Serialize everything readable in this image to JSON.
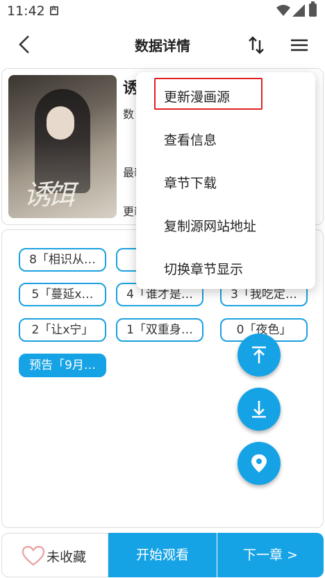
{
  "status": {
    "time": "11:42"
  },
  "header": {
    "title": "数据详情"
  },
  "info": {
    "title": "诱",
    "line1": "数",
    "line2": "最新",
    "line3": "更新"
  },
  "chapters": [
    {
      "label": "8「相识从…",
      "active": false
    },
    {
      "label": "7",
      "active": false
    },
    {
      "label": "5「蔓延x…",
      "active": false
    },
    {
      "label": "4「谁才是…",
      "active": false
    },
    {
      "label": "3「我吃定…",
      "active": false
    },
    {
      "label": "2「让x宁」",
      "active": false
    },
    {
      "label": "1「双重身…",
      "active": false
    },
    {
      "label": "0「夜色」",
      "active": false
    },
    {
      "label": "预告「9月…",
      "active": true
    }
  ],
  "menu": {
    "items": [
      "更新漫画源",
      "查看信息",
      "章节下载",
      "复制源网站地址",
      "切换章节显示"
    ]
  },
  "bottom": {
    "favorite": "未收藏",
    "start": "开始观看",
    "next": "下一章 >"
  },
  "colors": {
    "accent": "#16a3e6",
    "highlight": "#e02020"
  }
}
